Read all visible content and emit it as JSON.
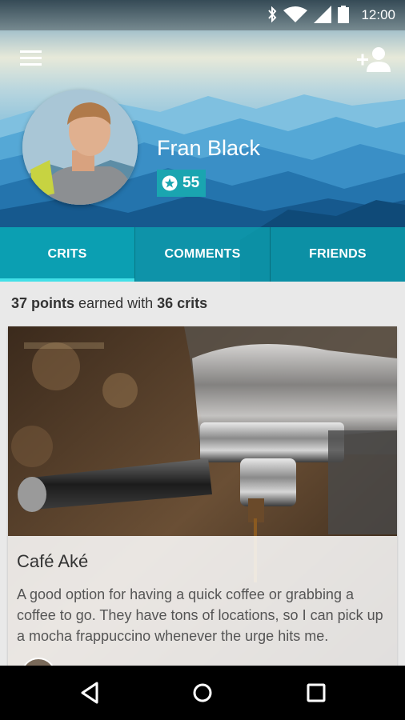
{
  "status_bar": {
    "time": "12:00",
    "icons": [
      "bluetooth-icon",
      "wifi-icon",
      "signal-icon",
      "battery-icon"
    ]
  },
  "header": {
    "menu_icon": "hamburger-menu-icon",
    "add_friend_icon": "add-person-icon"
  },
  "profile": {
    "name": "Fran Black",
    "score": "55",
    "score_icon": "star-circle-icon"
  },
  "tabs": [
    {
      "label": "CRITS",
      "active": true
    },
    {
      "label": "COMMENTS",
      "active": false
    },
    {
      "label": "FRIENDS",
      "active": false
    }
  ],
  "summary": {
    "points": "37 points",
    "middle": "earned with",
    "crits": "36 crits"
  },
  "card": {
    "title": "Café Aké",
    "text": "A good option for having a quick coffee or grabbing a coffee to go. They have tons of locations, so I can pick up a mocha frappuccino whenever the urge hits me."
  },
  "navbar": {
    "back_icon": "back-triangle-icon",
    "home_icon": "home-circle-icon",
    "recents_icon": "recents-square-icon"
  },
  "colors": {
    "accent": "#1aa5b0",
    "tab_indicator": "#43e0e8"
  }
}
